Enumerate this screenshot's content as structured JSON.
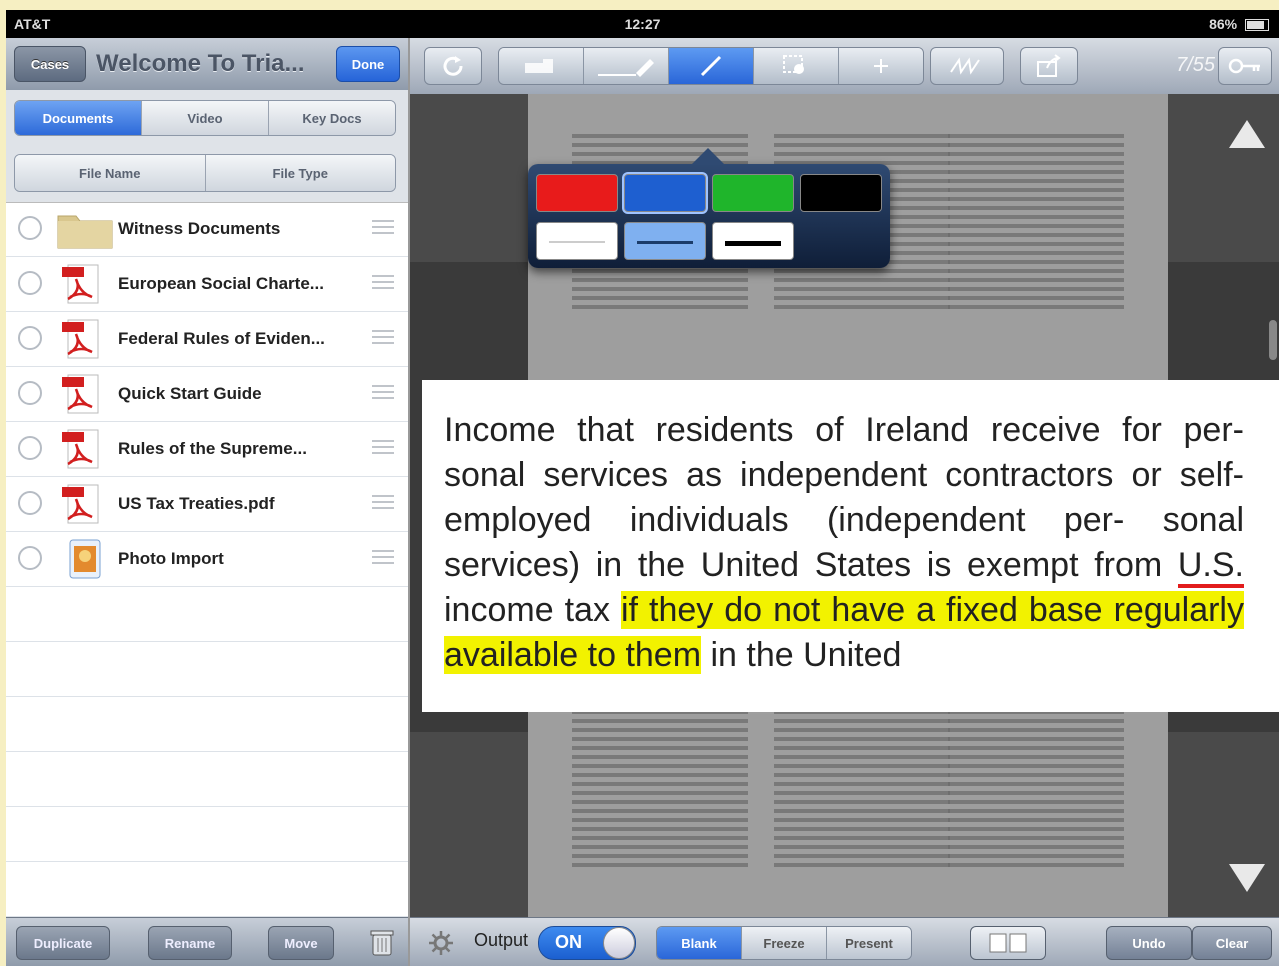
{
  "status": {
    "carrier": "AT&T",
    "time": "12:27",
    "battery": "86%"
  },
  "left": {
    "cases_label": "Cases",
    "title": "Welcome To Tria...",
    "done_label": "Done",
    "tabs": [
      "Documents",
      "Video",
      "Key Docs"
    ],
    "active_tab": "Documents",
    "sort": [
      "File Name",
      "File Type"
    ],
    "files": [
      {
        "name": "Witness Documents",
        "icon": "folder-icon"
      },
      {
        "name": "European Social Charte...",
        "icon": "pdf-icon"
      },
      {
        "name": "Federal Rules of Eviden...",
        "icon": "pdf-icon"
      },
      {
        "name": "Quick Start Guide",
        "icon": "pdf-icon"
      },
      {
        "name": "Rules of the Supreme...",
        "icon": "pdf-icon"
      },
      {
        "name": "US Tax Treaties.pdf",
        "icon": "pdf-icon"
      },
      {
        "name": "Photo Import",
        "icon": "photo-icon"
      }
    ],
    "bottom": {
      "duplicate": "Duplicate",
      "rename": "Rename",
      "move": "Move"
    }
  },
  "toolbar": {
    "page_indicator": "7/55",
    "active_tool": "pen"
  },
  "palette": {
    "colors": [
      "#e81b1b",
      "#1e5fd0",
      "#1fb52b",
      "#000000"
    ],
    "selected_color": "#1e5fd0",
    "selected_width": "medium"
  },
  "callout": {
    "text_before": "Income that residents of Ireland receive for per- sonal services as independent contractors or self-employed individuals (independent per- sonal services) in the United States is exempt from ",
    "underlined": "U.S.",
    "text_mid": " income tax ",
    "highlighted": "if they do not have a fixed base regularly available to them",
    "text_after": " in the United"
  },
  "bottom_right": {
    "output_label": "Output",
    "toggle_on": "ON",
    "modes": [
      "Blank",
      "Freeze",
      "Present"
    ],
    "active_mode": "Blank",
    "undo": "Undo",
    "clear": "Clear"
  }
}
